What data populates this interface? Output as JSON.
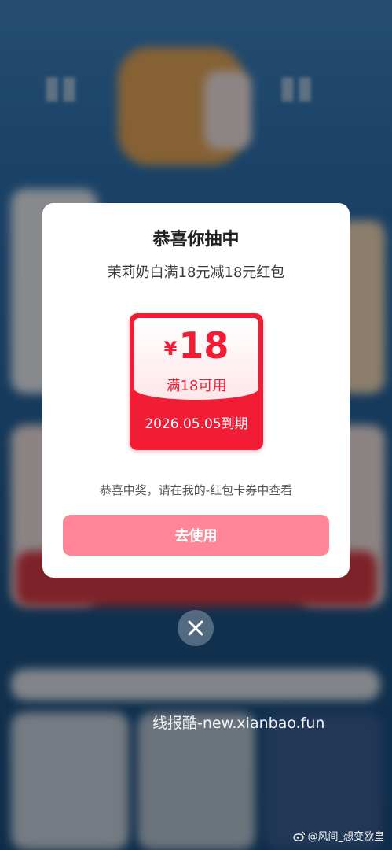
{
  "modal": {
    "title": "恭喜你抽中",
    "subtitle": "茉莉奶白满18元减18元红包",
    "coupon": {
      "currency": "¥",
      "amount": "18",
      "condition": "满18可用",
      "expiry": "2026.05.05到期"
    },
    "notice": "恭喜中奖，请在我的-红包卡券中查看",
    "use_button": "去使用"
  },
  "close_button": {
    "icon": "close-icon"
  },
  "watermark": "线报酷-new.xianbao.fun",
  "weibo_watermark": "@风间_想变欧皇",
  "colors": {
    "accent_red": "#f21c34",
    "button_pink": "#ff8597"
  }
}
